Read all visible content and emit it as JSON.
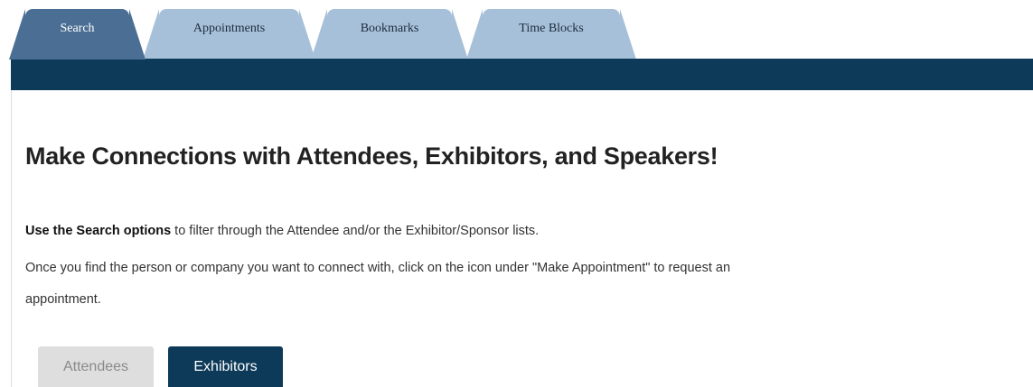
{
  "tabs": [
    {
      "label": "Search",
      "active": true
    },
    {
      "label": "Appointments",
      "active": false
    },
    {
      "label": "Bookmarks",
      "active": false
    },
    {
      "label": "Time Blocks",
      "active": false
    }
  ],
  "main": {
    "heading": "Make Connections with Attendees, Exhibitors, and Speakers!",
    "intro_bold": "Use the Search options",
    "intro_rest": " to filter through the Attendee and/or the Exhibitor/Sponsor lists.",
    "line2": "Once you find the person or company you want to connect with, click on the icon under \"Make Appointment\" to request an",
    "line3": "appointment."
  },
  "toggle": {
    "attendees_label": "Attendees",
    "exhibitors_label": "Exhibitors",
    "selected": "Exhibitors"
  },
  "colors": {
    "band": "#0d3a59",
    "tab_active": "#4b6f94",
    "tab_inactive": "#a7c0d9",
    "button_active": "#0d3a59",
    "button_inactive": "#dedede"
  }
}
